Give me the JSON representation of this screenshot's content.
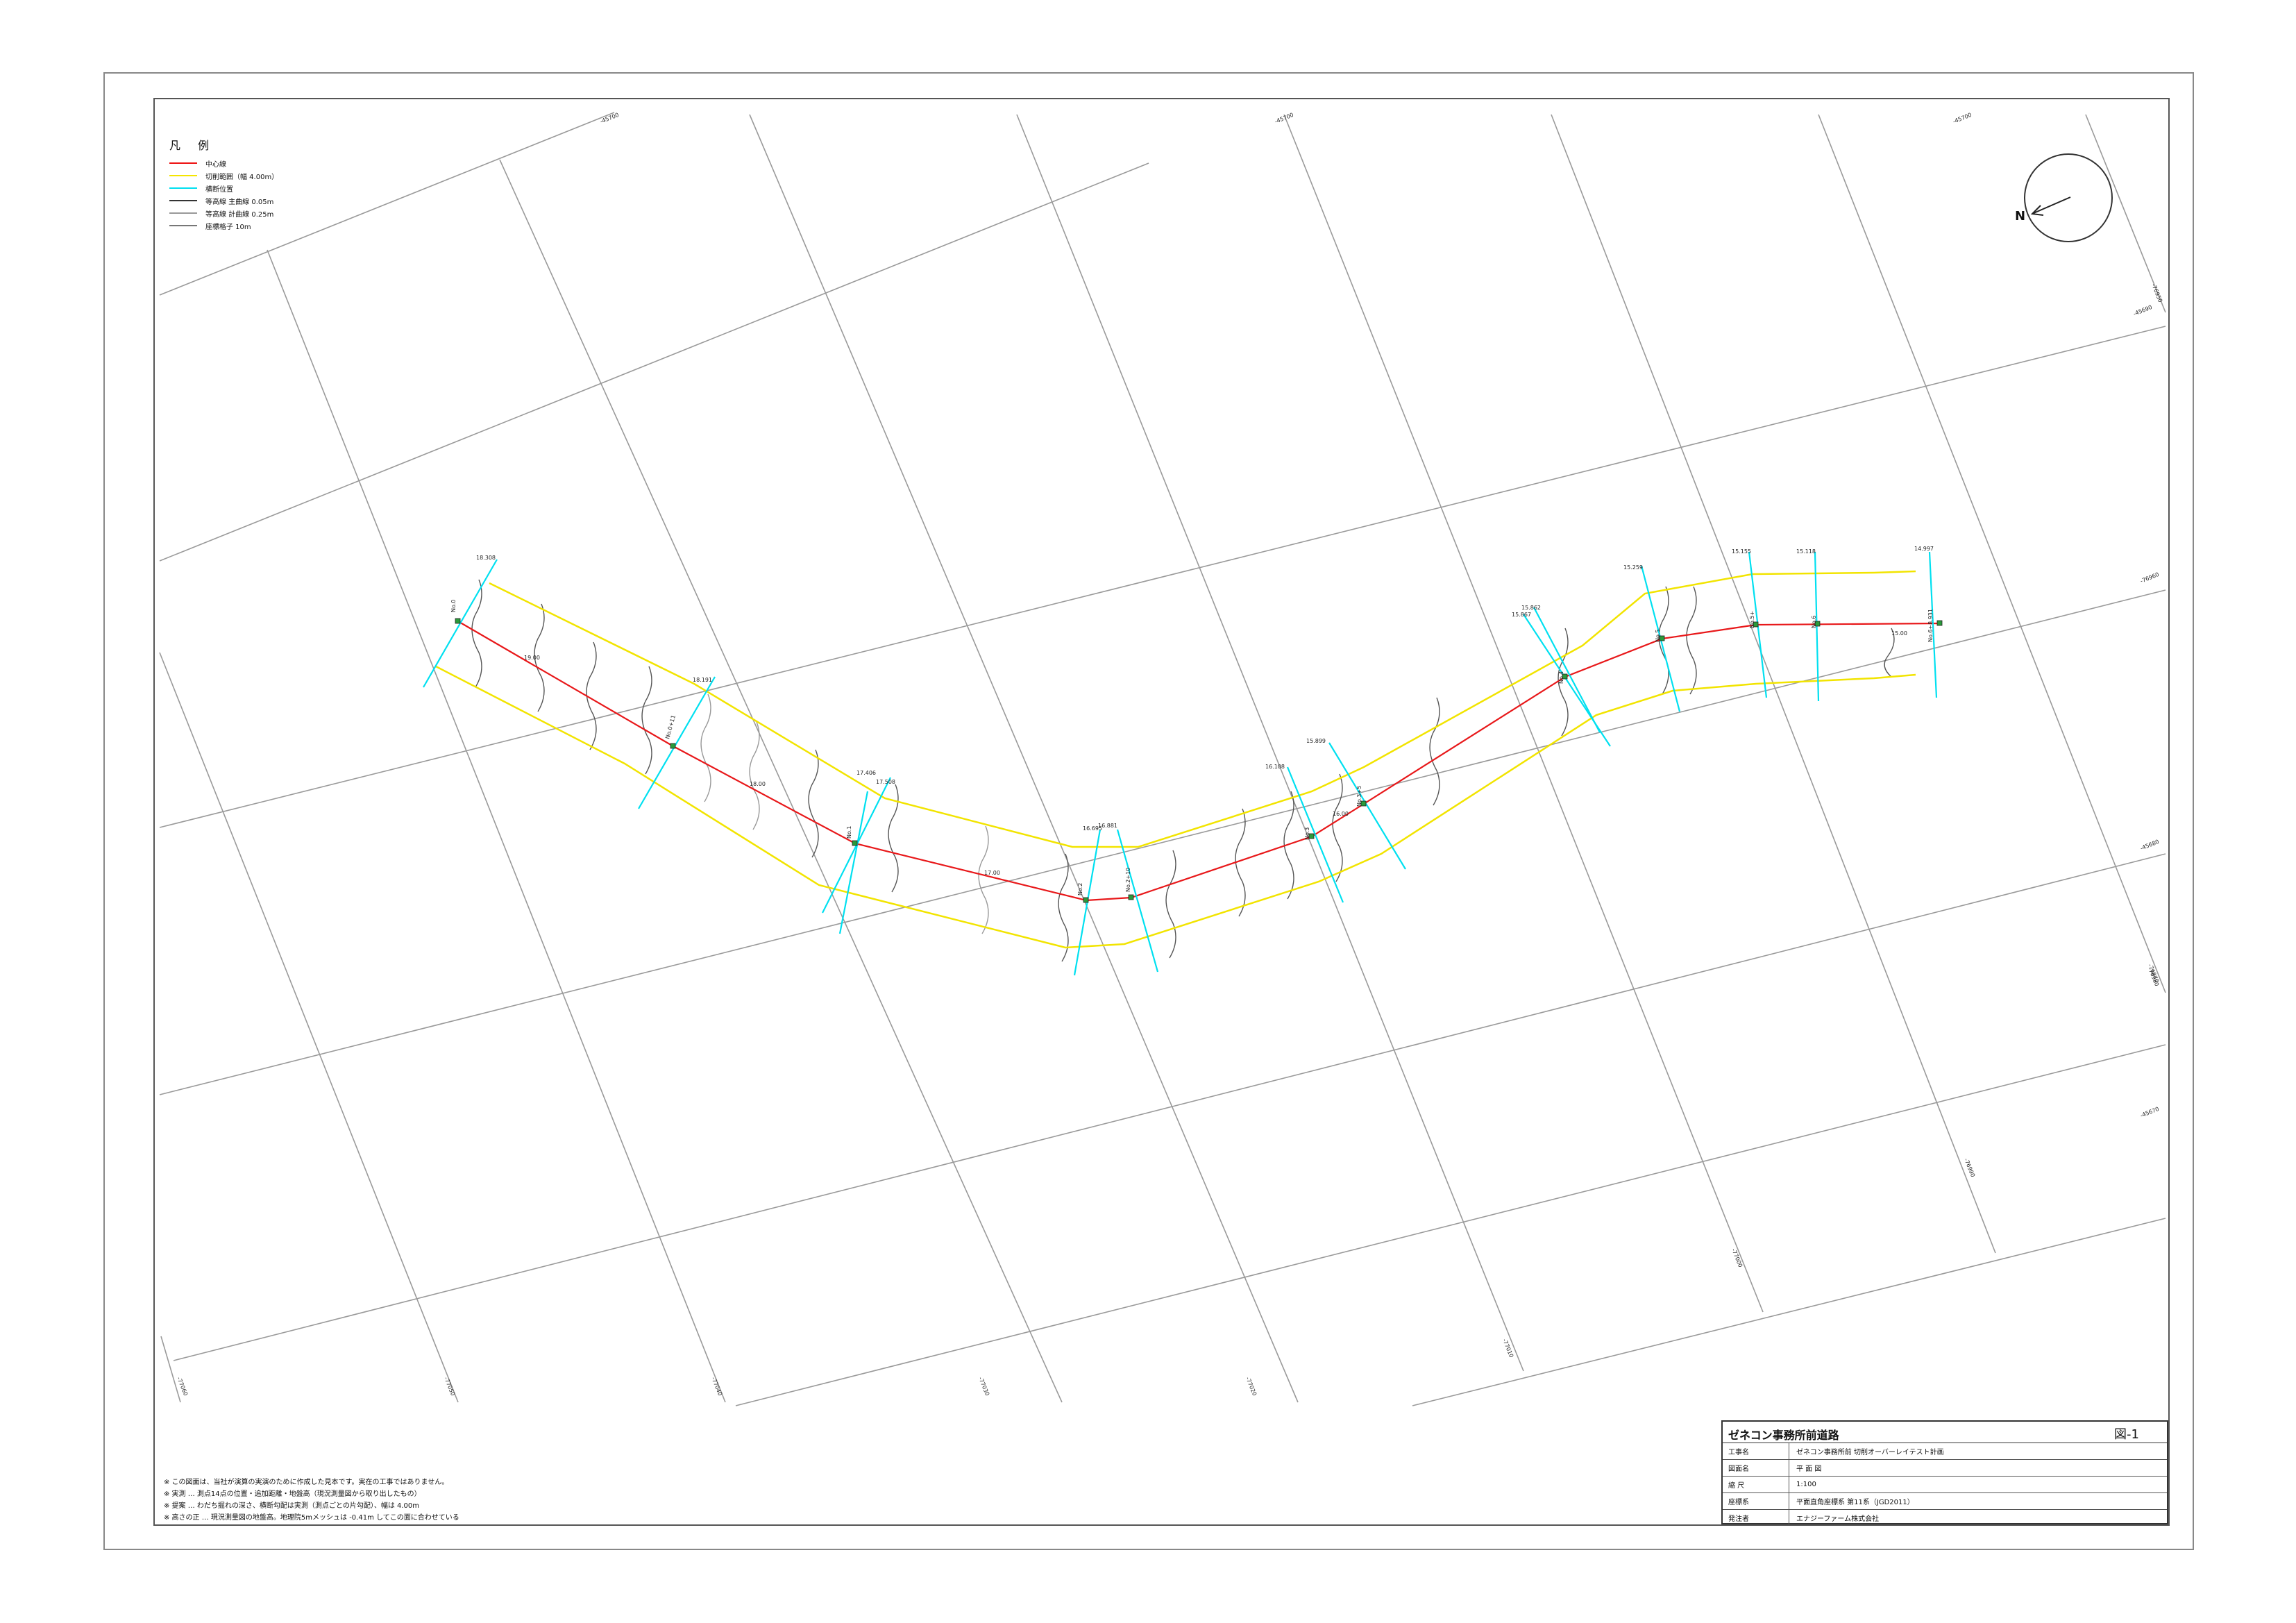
{
  "legend": {
    "title": "凡 例",
    "items": [
      {
        "label": "中心線",
        "color": "#ee1111"
      },
      {
        "label": "切削範囲（幅 4.00m）",
        "color": "#f5e500"
      },
      {
        "label": "横断位置",
        "color": "#00e0f0"
      },
      {
        "label": "等高線 主曲線 0.05m",
        "color": "#333333"
      },
      {
        "label": "等高線 計曲線 0.25m",
        "color": "#999999"
      },
      {
        "label": "座標格子 10m",
        "color": "#777777"
      }
    ]
  },
  "north_arrow": {
    "label": "N"
  },
  "grid_labels": {
    "top": [
      "-45700",
      "-45700",
      "-45700"
    ],
    "right": [
      "-76950",
      "-45690",
      "-76960",
      "-45680",
      "-76970",
      "-45670"
    ],
    "bottom": [
      "-77060",
      "-77050",
      "-77040",
      "-77030",
      "-77020",
      "-77010",
      "-77000",
      "-76990",
      "-76980"
    ]
  },
  "stations": [
    {
      "name": "No.0",
      "elev": "18.308"
    },
    {
      "name": "No.0+11",
      "elev": "18.191"
    },
    {
      "name": "No.1",
      "elev": "17.406"
    },
    {
      "name": "No.1+",
      "elev": "17.508"
    },
    {
      "name": "No.2",
      "elev": "16.695"
    },
    {
      "name": "No.2+10",
      "elev": "16.881"
    },
    {
      "name": "No.3",
      "elev": "16.108"
    },
    {
      "name": "No.3+5",
      "elev": "15.899"
    },
    {
      "name": "No.4",
      "elev": "15.862"
    },
    {
      "name": "No.4+",
      "elev": "15.867"
    },
    {
      "name": "No.5",
      "elev": "15.259"
    },
    {
      "name": "No.5+",
      "elev": "15.155"
    },
    {
      "name": "No.6",
      "elev": "15.118"
    },
    {
      "name": "No.6+8.931",
      "elev": "14.997"
    }
  ],
  "spans": [
    "19.00",
    "18.00",
    "17.00",
    "16.00",
    "15.00"
  ],
  "notes": [
    "※ この図面は、当社が演算の実演のために作成した見本です。実在の工事ではありません。",
    "※ 実測 … 測点14点の位置・追加距離・地盤高（現況測量図から取り出したもの）",
    "※ 提案 … わだち掘れの深さ、横断勾配は実測（測点ごとの片勾配）、幅は 4.00m",
    "※ 高さの正 … 現況測量図の地盤高。地理院5mメッシュは -0.41m してこの面に合わせている"
  ],
  "title_block": {
    "title": "ゼネコン事務所前道路",
    "drawing_no": "図-1",
    "rows": [
      {
        "key": "工事名",
        "value": "ゼネコン事務所前 切削オーバーレイテスト計画"
      },
      {
        "key": "図面名",
        "value": "平 面 図"
      },
      {
        "key": "縮 尺",
        "value": "1:100"
      },
      {
        "key": "座標系",
        "value": "平面直角座標系 第11系（JGD2011）"
      },
      {
        "key": "発注者",
        "value": "エナジーファーム株式会社"
      }
    ]
  }
}
